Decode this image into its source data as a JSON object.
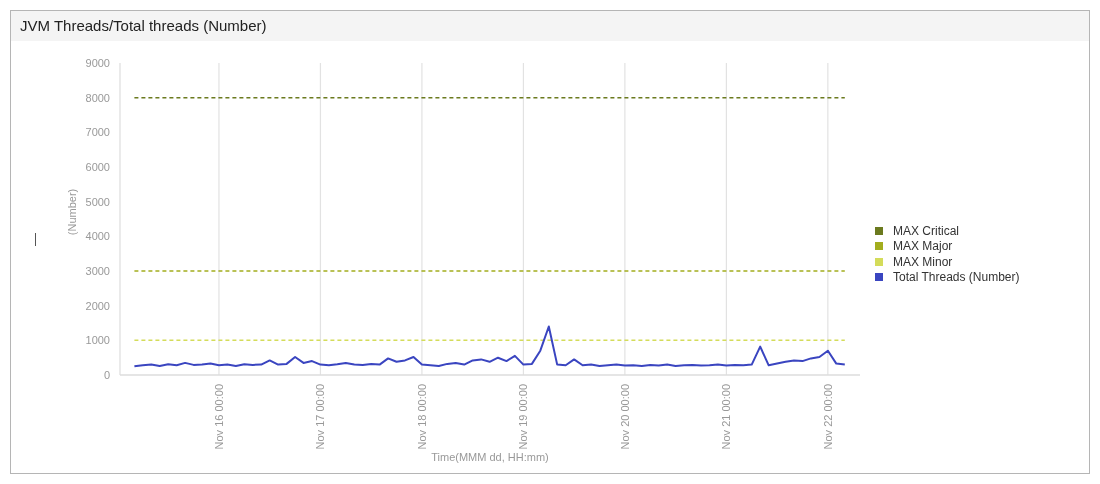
{
  "panel": {
    "title": "JVM Threads/Total threads (Number)"
  },
  "chart_data": {
    "type": "line",
    "xlabel": "Time(MMM dd, HH:mm)",
    "ylabel": "(Number)",
    "ylim": [
      0,
      9000
    ],
    "grid": true,
    "yticks": [
      0,
      1000,
      2000,
      3000,
      4000,
      5000,
      6000,
      7000,
      8000,
      9000
    ],
    "categories": [
      null,
      null,
      null,
      null,
      null,
      null,
      null,
      null,
      null,
      null,
      "Nov 16 00:00",
      null,
      null,
      null,
      null,
      null,
      null,
      null,
      null,
      null,
      null,
      null,
      "Nov 17 00:00",
      null,
      null,
      null,
      null,
      null,
      null,
      null,
      null,
      null,
      null,
      null,
      "Nov 18 00:00",
      null,
      null,
      null,
      null,
      null,
      null,
      null,
      null,
      null,
      null,
      null,
      "Nov 19 00:00",
      null,
      null,
      null,
      null,
      null,
      null,
      null,
      null,
      null,
      null,
      null,
      "Nov 20 00:00",
      null,
      null,
      null,
      null,
      null,
      null,
      null,
      null,
      null,
      null,
      null,
      "Nov 21 00:00",
      null,
      null,
      null,
      null,
      null,
      null,
      null,
      null,
      null,
      null,
      null,
      "Nov 22 00:00",
      null,
      null
    ],
    "series": [
      {
        "name": "MAX Critical",
        "color": "#6b7a1e",
        "line_style": "dashed",
        "values": [
          8000,
          8000,
          8000,
          8000,
          8000,
          8000,
          8000,
          8000,
          8000,
          8000,
          8000,
          8000,
          8000,
          8000,
          8000,
          8000,
          8000,
          8000,
          8000,
          8000,
          8000,
          8000,
          8000,
          8000,
          8000,
          8000,
          8000,
          8000,
          8000,
          8000,
          8000,
          8000,
          8000,
          8000,
          8000,
          8000,
          8000,
          8000,
          8000,
          8000,
          8000,
          8000,
          8000,
          8000,
          8000,
          8000,
          8000,
          8000,
          8000,
          8000,
          8000,
          8000,
          8000,
          8000,
          8000,
          8000,
          8000,
          8000,
          8000,
          8000,
          8000,
          8000,
          8000,
          8000,
          8000,
          8000,
          8000,
          8000,
          8000,
          8000,
          8000,
          8000,
          8000,
          8000,
          8000,
          8000,
          8000,
          8000,
          8000,
          8000,
          8000,
          8000,
          8000,
          8000,
          8000
        ]
      },
      {
        "name": "MAX Major",
        "color": "#a3ad1e",
        "line_style": "dashed",
        "values": [
          3000,
          3000,
          3000,
          3000,
          3000,
          3000,
          3000,
          3000,
          3000,
          3000,
          3000,
          3000,
          3000,
          3000,
          3000,
          3000,
          3000,
          3000,
          3000,
          3000,
          3000,
          3000,
          3000,
          3000,
          3000,
          3000,
          3000,
          3000,
          3000,
          3000,
          3000,
          3000,
          3000,
          3000,
          3000,
          3000,
          3000,
          3000,
          3000,
          3000,
          3000,
          3000,
          3000,
          3000,
          3000,
          3000,
          3000,
          3000,
          3000,
          3000,
          3000,
          3000,
          3000,
          3000,
          3000,
          3000,
          3000,
          3000,
          3000,
          3000,
          3000,
          3000,
          3000,
          3000,
          3000,
          3000,
          3000,
          3000,
          3000,
          3000,
          3000,
          3000,
          3000,
          3000,
          3000,
          3000,
          3000,
          3000,
          3000,
          3000,
          3000,
          3000,
          3000,
          3000,
          3000
        ]
      },
      {
        "name": "MAX Minor",
        "color": "#d4dc5a",
        "line_style": "dashed",
        "values": [
          1000,
          1000,
          1000,
          1000,
          1000,
          1000,
          1000,
          1000,
          1000,
          1000,
          1000,
          1000,
          1000,
          1000,
          1000,
          1000,
          1000,
          1000,
          1000,
          1000,
          1000,
          1000,
          1000,
          1000,
          1000,
          1000,
          1000,
          1000,
          1000,
          1000,
          1000,
          1000,
          1000,
          1000,
          1000,
          1000,
          1000,
          1000,
          1000,
          1000,
          1000,
          1000,
          1000,
          1000,
          1000,
          1000,
          1000,
          1000,
          1000,
          1000,
          1000,
          1000,
          1000,
          1000,
          1000,
          1000,
          1000,
          1000,
          1000,
          1000,
          1000,
          1000,
          1000,
          1000,
          1000,
          1000,
          1000,
          1000,
          1000,
          1000,
          1000,
          1000,
          1000,
          1000,
          1000,
          1000,
          1000,
          1000,
          1000,
          1000,
          1000,
          1000,
          1000,
          1000,
          1000
        ]
      },
      {
        "name": "Total Threads (Number)",
        "color": "#3a45c0",
        "values": [
          250,
          280,
          300,
          260,
          310,
          280,
          350,
          290,
          300,
          330,
          280,
          300,
          260,
          310,
          290,
          300,
          420,
          300,
          320,
          520,
          350,
          400,
          300,
          280,
          310,
          350,
          300,
          290,
          320,
          300,
          480,
          380,
          420,
          520,
          300,
          280,
          260,
          320,
          350,
          300,
          420,
          450,
          380,
          500,
          400,
          550,
          300,
          320,
          700,
          1400,
          300,
          280,
          450,
          280,
          300,
          260,
          280,
          300,
          270,
          280,
          260,
          290,
          270,
          300,
          260,
          280,
          290,
          270,
          280,
          300,
          270,
          290,
          280,
          300,
          820,
          280,
          330,
          380,
          420,
          400,
          480,
          520,
          700,
          330,
          300
        ]
      }
    ]
  }
}
